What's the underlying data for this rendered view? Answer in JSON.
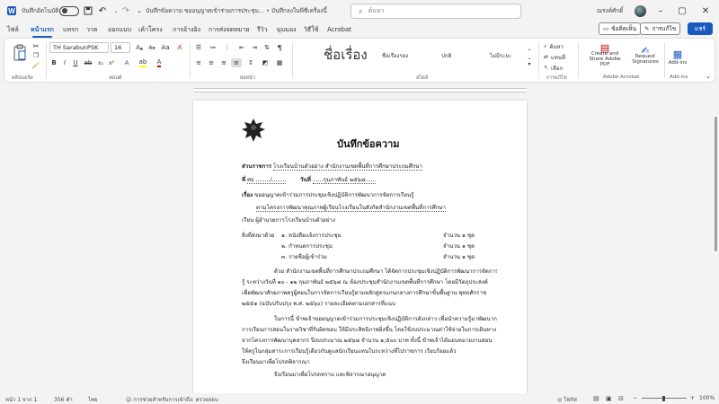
{
  "titlebar": {
    "autosave_label": "บันทึกอัตโนมัติ",
    "doc_title": "บันทึกข้อความ ขออนุญาตเข้าร่วมการประชุม...  •  บันทึกลงในพีซีเครื่องนี้",
    "search_placeholder": "ค้นหา",
    "user_name": "ณรงค์ศักดิ์"
  },
  "tabs": [
    "ไฟล์",
    "หน้าแรก",
    "แทรก",
    "วาด",
    "ออกแบบ",
    "เค้าโครง",
    "การอ้างอิง",
    "การส่งจดหมาย",
    "รีวิว",
    "มุมมอง",
    "วิธีใช้",
    "Acrobat"
  ],
  "active_tab": "หน้าแรก",
  "top_buttons": {
    "comments": "ข้อคิดเห็น",
    "editing": "การแก้ไข",
    "share": "แชร์"
  },
  "ribbon": {
    "font_name": "TH SarabunPSK",
    "font_size": "16",
    "styles": [
      {
        "label": "ชื่อเรื่อง",
        "size": "big"
      },
      {
        "label": "ชื่อเรื่องรอง",
        "size": "small"
      },
      {
        "label": "ปกติ",
        "size": "small"
      },
      {
        "label": "ไม่มีระยะ",
        "size": "small"
      }
    ],
    "groups": [
      "คลิปบอร์ด",
      "ฟอนต์",
      "ย่อหน้า",
      "สไตล์",
      "การแก้ไข",
      "Adobe Acrobat",
      "Add-ins"
    ],
    "editing_items": [
      "ค้นหา",
      "แทนที่",
      "เลือก"
    ],
    "acrobat_items": [
      "Create and Share Adobe PDF",
      "Request Signatures"
    ],
    "addins_label": "Add-ins"
  },
  "document": {
    "title": "บันทึกข้อความ",
    "lines": [
      {
        "label": "ส่วนราชการ",
        "text": "โรงเรียนบ้านตัวอย่าง สำนักงานเขตพื้นที่การศึกษาประถมศึกษา"
      },
      {
        "label": "ที่",
        "text": "ศธ ......../........",
        "label2": "วันที่",
        "text2": "......กุมภาพันธ์ ๒๕๖๘......"
      },
      {
        "label": "เรื่อง",
        "text": "ขออนุญาตเข้าร่วมการประชุมเชิงปฏิบัติการพัฒนาการจัดการเรียนรู้"
      },
      {
        "label": "",
        "text": "ตามโครงการพัฒนาคุณภาพผู้เรียนโรงเรียนในสังกัดสำนักงานเขตพื้นที่การศึกษา"
      },
      {
        "label": "เรียน",
        "text": "ผู้อำนวยการโรงเรียนบ้านตัวอย่าง"
      }
    ],
    "attachments_label": "สิ่งที่ส่งมาด้วย",
    "attachments": [
      {
        "item": "๑. หนังสือแจ้งการประชุม",
        "count": "จำนวน ๑ ชุด"
      },
      {
        "item": "๒. กำหนดการประชุม",
        "count": "จำนวน ๑ ชุด"
      },
      {
        "item": "๓. รายชื่อผู้เข้าร่วม",
        "count": "จำนวน ๑ ชุด"
      }
    ],
    "para1": [
      "ด้วย สำนักงานเขตพื้นที่การศึกษาประถมศึกษา ได้จัดการประชุมเชิงปฏิบัติการพัฒนาการจัดการเรียน",
      "รู้ ระหว่างวันที่ ๑๐ - ๑๒ กุมภาพันธ์ ๒๕๖๘ ณ ห้องประชุมสำนักงานเขตพื้นที่การศึกษา โดยมีวัตถุประสงค์",
      "เพื่อพัฒนาศักยภาพครูผู้สอนในการจัดการเรียนรู้ตามหลักสูตรแกนกลางการศึกษาขั้นพื้นฐาน พุทธศักราช",
      "๒๕๕๑ (ฉบับปรับปรุง พ.ศ. ๒๕๖๐)                                        รายละเอียดตามเอกสารที่แนบ"
    ],
    "para2": [
      "ในการนี้ ข้าพเจ้าขออนุญาตเข้าร่วมการประชุมเชิงปฏิบัติการดังกล่าว เพื่อนำความรู้มาพัฒนาการจัด",
      "การเรียนการสอนในรายวิชาที่รับผิดชอบ ให้มีประสิทธิภาพยิ่งขึ้น โดยใช้งบประมาณค่าใช้จ่ายในการเดินทาง",
      "จากโครงการพัฒนาบุคลากร ปีงบประมาณ ๒๕๖๘ จำนวน ๑,๕๐๐ บาท ทั้งนี้ ข้าพเจ้าได้มอบหมายงานสอน",
      "ให้ครูในกลุ่มสาระการเรียนรู้เดียวกันดูแลนักเรียนแทนในระหว่างที่ไปราชการ เรียบร้อยแล้ว",
      "จึงเรียนมาเพื่อโปรดพิจารณา"
    ],
    "closing": "จึงเรียนมาเพื่อโปรดทราบ และพิจารณาอนุญาต"
  },
  "statusbar": {
    "page": "หน้า 1 จาก 1",
    "words": "356 คำ",
    "language": "ไทย",
    "accessibility": "การช่วยสำหรับการเข้าถึง: ตรวจสอบ",
    "focus": "โฟกัส",
    "zoom": "100%"
  }
}
